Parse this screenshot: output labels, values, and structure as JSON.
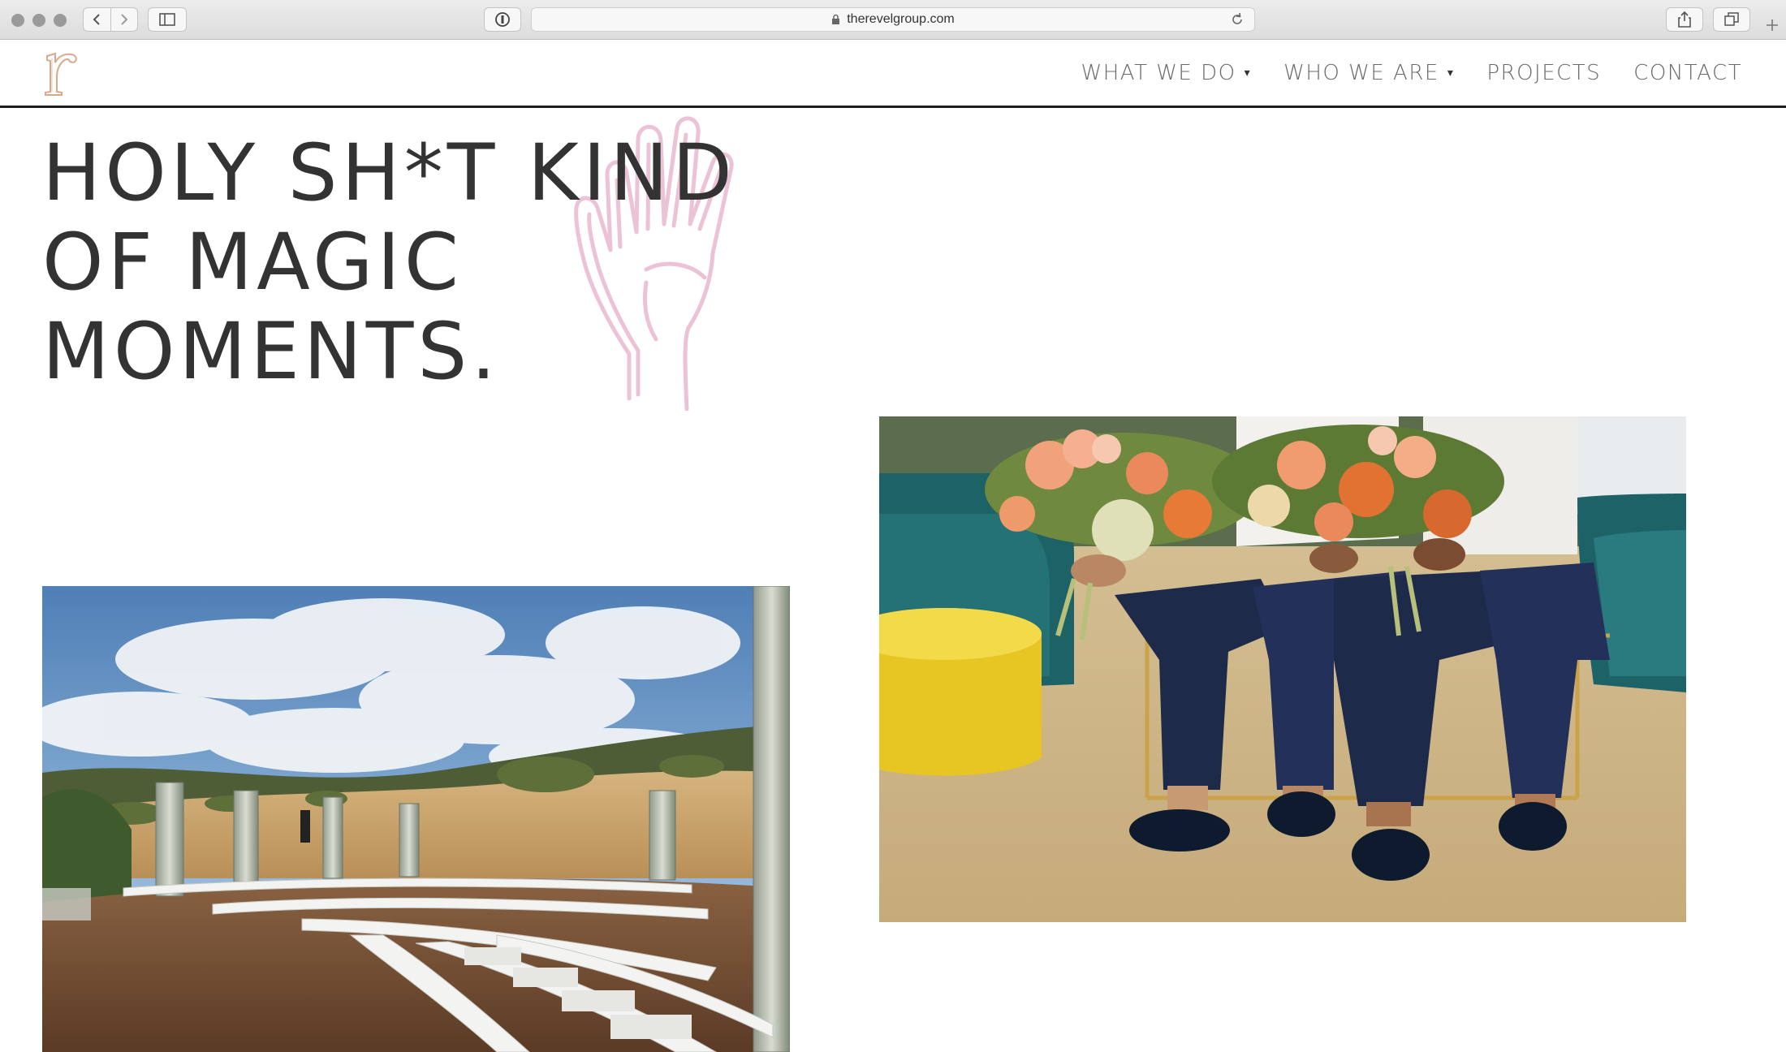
{
  "browser": {
    "url": "therevelgroup.com"
  },
  "site": {
    "logo_letter": "r",
    "nav": [
      {
        "label": "WHAT WE DO",
        "dropdown": true
      },
      {
        "label": "WHO WE ARE",
        "dropdown": true
      },
      {
        "label": "PROJECTS",
        "dropdown": false
      },
      {
        "label": "CONTACT",
        "dropdown": false
      }
    ],
    "dropdown_caret": "▾"
  },
  "hero": {
    "lines": [
      "HOLY SH*T KIND",
      "OF MAGIC",
      "MOMENTS."
    ],
    "decoration_icon": "hand-outline-icon"
  },
  "colors": {
    "accent_pink": "#ecc2d6",
    "logo_gold": "#d9a98c",
    "text_dark": "#333333",
    "nav_gray": "#6a6a6a"
  }
}
